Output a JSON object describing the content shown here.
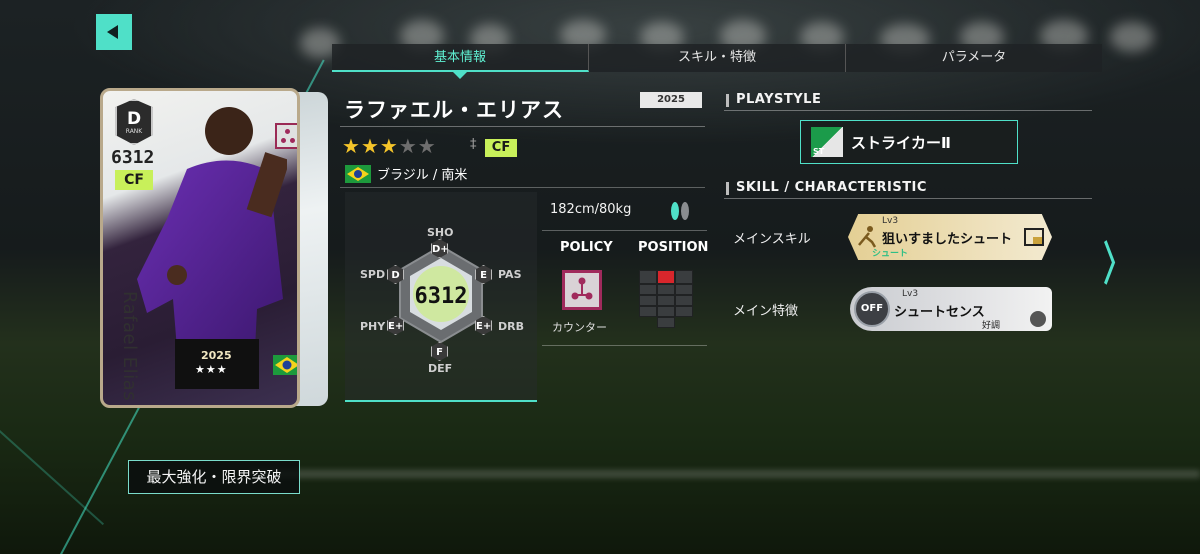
{
  "tabs": [
    {
      "label": "基本情報",
      "active": true
    },
    {
      "label": "スキル・特徴",
      "active": false
    },
    {
      "label": "パラメータ",
      "active": false
    }
  ],
  "card": {
    "rank": "D",
    "rank_label": "RANK",
    "ovr": "6312",
    "position": "CF",
    "name": "Rafael Elias",
    "year": "2025",
    "stars": "★★★",
    "policy_icon": "counter-policy-icon",
    "flag_icon": "brazil-flag-icon"
  },
  "player": {
    "name": "ラファエル・エリアス",
    "season": "2025",
    "rarity_stars_on": 3,
    "rarity_stars_total": 5,
    "position": "CF",
    "nation": "ブラジル / 南米",
    "height_weight": "182cm/80kg"
  },
  "stats": {
    "ovr": "6312",
    "labels": {
      "sho": "SHO",
      "pas": "PAS",
      "drb": "DRB",
      "def": "DEF",
      "phy": "PHY",
      "spd": "SPD"
    },
    "grades": {
      "sho": "D+",
      "pas": "E",
      "drb": "E+",
      "def": "F",
      "phy": "E+",
      "spd": "D"
    }
  },
  "policy": {
    "title": "POLICY",
    "label": "カウンター"
  },
  "position_map": {
    "title": "POSITION"
  },
  "playstyle": {
    "heading": "PLAYSTYLE",
    "badge": "ST",
    "label": "ストライカーⅡ"
  },
  "skill_section": {
    "heading": "SKILL / CHARACTERISTIC",
    "main_skill_label": "メインスキル",
    "main_skill": {
      "level": "Lv3",
      "name": "狙いすましたシュート",
      "type": "シュート"
    },
    "main_trait_label": "メイン特徴",
    "main_trait": {
      "badge": "OFF",
      "level": "Lv3",
      "name": "シュートセンス",
      "condition": "好調"
    }
  },
  "upgrade_button": "最大強化・限界突破",
  "colors": {
    "accent": "#4fe0c8",
    "position_tag": "#c8f05a",
    "star_on": "#f5c52a",
    "policy": "#a02a5c"
  }
}
